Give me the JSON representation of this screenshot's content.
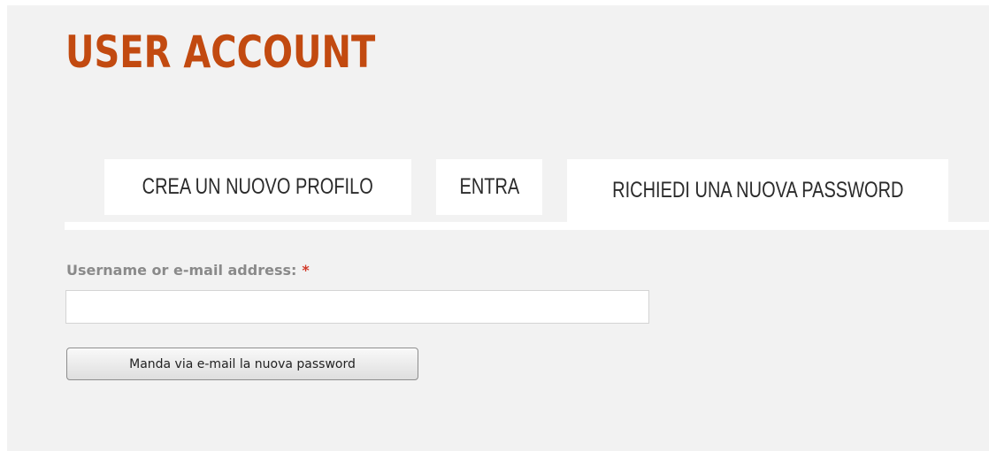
{
  "page": {
    "title": "USER ACCOUNT"
  },
  "tabs": [
    {
      "label": "CREA UN NUOVO PROFILO",
      "active": false
    },
    {
      "label": "ENTRA",
      "active": false
    },
    {
      "label": "RICHIEDI UNA NUOVA PASSWORD",
      "active": true
    }
  ],
  "form": {
    "identifier_label": "Username or e-mail address:",
    "required_marker": "*",
    "identifier_value": "",
    "submit_label": "Manda via e-mail la nuova password"
  },
  "colors": {
    "title": "#c24a10",
    "background": "#f2f2f2",
    "tab_background": "#ffffff",
    "required": "#d23a2a",
    "label": "#8a8a8a"
  }
}
